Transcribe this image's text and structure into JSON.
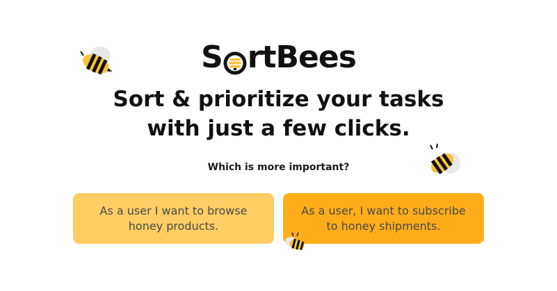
{
  "brand": {
    "name_prefix": "S",
    "name_suffix": "rtBees",
    "logo_icon": "honeycomb-o-icon"
  },
  "hero": {
    "line1": "Sort & prioritize your tasks",
    "line2": "with just a few clicks."
  },
  "prompt": {
    "question": "Which is more important?"
  },
  "choices": [
    {
      "label": "As a user I want to browse honey products.",
      "color": "#fecd63"
    },
    {
      "label": "As a user, I want to subscribe to honey shipments.",
      "color": "#ffad1b"
    }
  ],
  "decor": {
    "icons": [
      "bee-icon",
      "bee-icon",
      "bee-icon"
    ],
    "bee_yellow": "#f9c23c",
    "bee_black": "#111111",
    "wing_gray": "#e8e8e8"
  }
}
